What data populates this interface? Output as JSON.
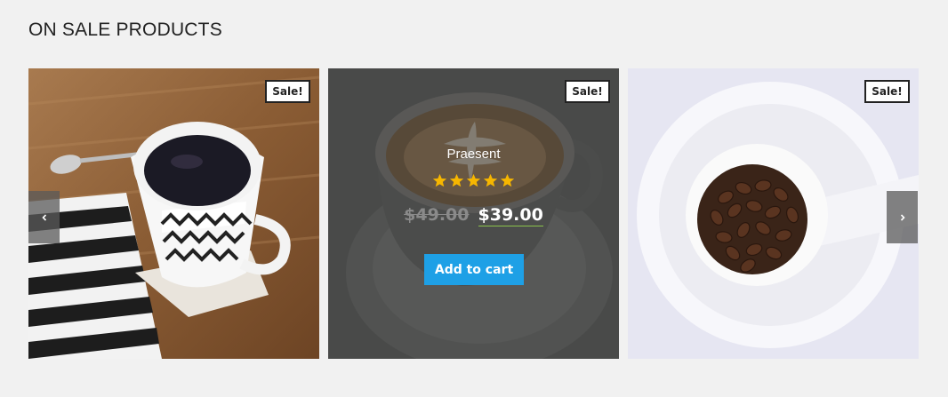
{
  "section": {
    "title": "ON SALE PRODUCTS"
  },
  "products": [
    {
      "badge": "Sale!",
      "image": "coffee-cup-striped-mug"
    },
    {
      "badge": "Sale!",
      "image": "latte-art-cup",
      "name": "Praesent",
      "rating": 5,
      "price_old": "$49.00",
      "price_new": "$39.00",
      "cta": "Add to cart"
    },
    {
      "badge": "Sale!",
      "image": "coffee-beans-cup"
    }
  ],
  "nav": {
    "prev_icon": "chevron-left-icon",
    "next_icon": "chevron-right-icon"
  },
  "colors": {
    "cta": "#1ea0e6",
    "star": "#f6b600",
    "badge_border": "#222222",
    "background": "#f1f1f1"
  }
}
